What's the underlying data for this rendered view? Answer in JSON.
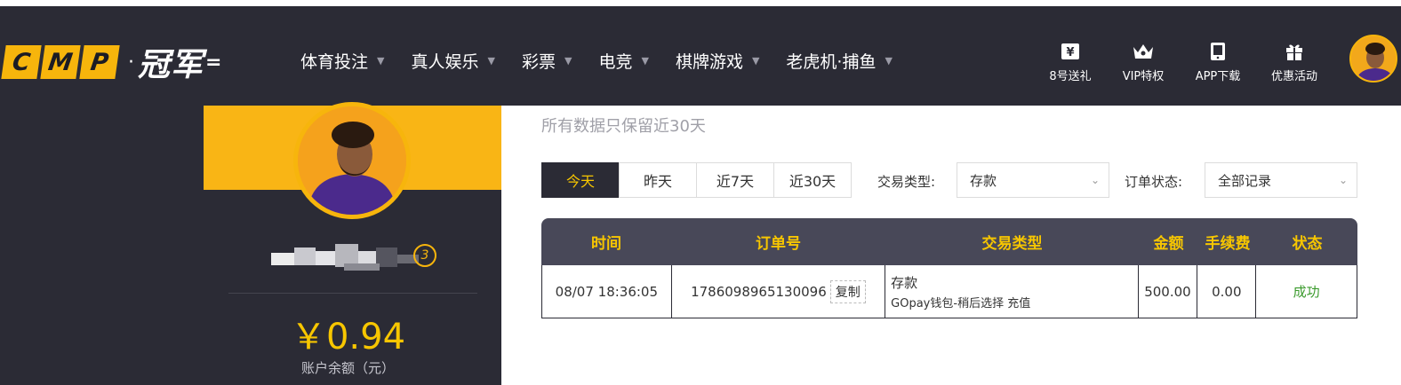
{
  "header": {
    "logo": {
      "letters": [
        "C",
        "M",
        "P"
      ],
      "dot": "·",
      "cn": "冠军",
      "tail": "="
    },
    "nav": [
      {
        "label": "体育投注"
      },
      {
        "label": "真人娱乐"
      },
      {
        "label": "彩票"
      },
      {
        "label": "电竞"
      },
      {
        "label": "棋牌游戏"
      },
      {
        "label": "老虎机·捕鱼"
      }
    ],
    "quick_links": [
      {
        "label": "8号送礼",
        "icon": "yen-gift-icon"
      },
      {
        "label": "VIP特权",
        "icon": "crown-icon"
      },
      {
        "label": "APP下载",
        "icon": "phone-icon"
      },
      {
        "label": "优惠活动",
        "icon": "gift-icon"
      }
    ]
  },
  "profile": {
    "vip_level": "3",
    "balance": "￥0.94",
    "balance_label": "账户余额（元）"
  },
  "notice": "所有数据只保留近30天",
  "date_filters": [
    {
      "label": "今天",
      "active": true
    },
    {
      "label": "昨天",
      "active": false
    },
    {
      "label": "近7天",
      "active": false
    },
    {
      "label": "近30天",
      "active": false
    }
  ],
  "filters": {
    "type_label": "交易类型:",
    "type_value": "存款",
    "status_label": "订单状态:",
    "status_value": "全部记录"
  },
  "table": {
    "headers": [
      "时间",
      "订单号",
      "交易类型",
      "金额",
      "手续费",
      "状态"
    ],
    "rows": [
      {
        "time": "08/07 18:36:05",
        "order_no": "1786098965130096",
        "copy": "复制",
        "type": "存款",
        "type_detail": "GOpay钱包-稍后选择 充值",
        "amount": "500.00",
        "fee": "0.00",
        "status": "成功"
      }
    ]
  },
  "colors": {
    "dark": "#2b2b35",
    "accent": "#f7c600",
    "success": "#3a9a2c"
  }
}
